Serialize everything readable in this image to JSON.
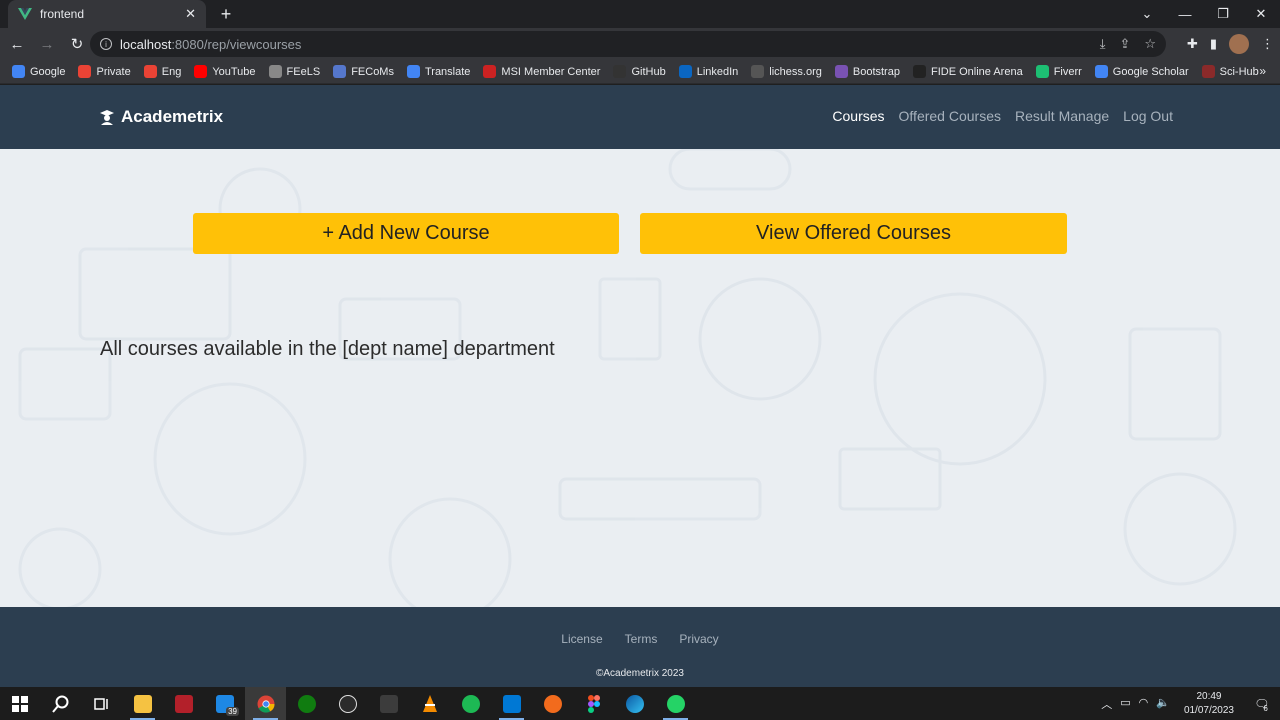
{
  "browser": {
    "tab_title": "frontend",
    "url_host": "localhost",
    "url_rest": ":8080/rep/viewcourses",
    "bookmarks": [
      {
        "label": "Google",
        "icon": "google-icon",
        "color": "#4285f4"
      },
      {
        "label": "Private",
        "icon": "gmail-icon",
        "color": "#ea4335"
      },
      {
        "label": "Eng",
        "icon": "gmail-icon",
        "color": "#ea4335"
      },
      {
        "label": "YouTube",
        "icon": "youtube-icon",
        "color": "#ff0000"
      },
      {
        "label": "FEeLS",
        "icon": "feels-icon",
        "color": "#888888"
      },
      {
        "label": "FECoMs",
        "icon": "fecoms-icon",
        "color": "#5577cc"
      },
      {
        "label": "Translate",
        "icon": "translate-icon",
        "color": "#4285f4"
      },
      {
        "label": "MSI Member Center",
        "icon": "msi-icon",
        "color": "#cc2222"
      },
      {
        "label": "GitHub",
        "icon": "github-icon",
        "color": "#333333"
      },
      {
        "label": "LinkedIn",
        "icon": "linkedin-icon",
        "color": "#0a66c2"
      },
      {
        "label": "lichess.org",
        "icon": "lichess-icon",
        "color": "#555555"
      },
      {
        "label": "Bootstrap",
        "icon": "bootstrap-icon",
        "color": "#7952b3"
      },
      {
        "label": "FIDE Online Arena",
        "icon": "fide-icon",
        "color": "#222222"
      },
      {
        "label": "Fiverr",
        "icon": "fiverr-icon",
        "color": "#1dbf73"
      },
      {
        "label": "Google Scholar",
        "icon": "scholar-icon",
        "color": "#4285f4"
      },
      {
        "label": "Sci-Hub",
        "icon": "scihub-icon",
        "color": "#8b2a2a"
      }
    ]
  },
  "navbar": {
    "brand": "Academetrix",
    "links": [
      {
        "label": "Courses",
        "active": true
      },
      {
        "label": "Offered Courses",
        "active": false
      },
      {
        "label": "Result Manage",
        "active": false
      },
      {
        "label": "Log Out",
        "active": false
      }
    ]
  },
  "main": {
    "add_button": "+ Add New Course",
    "view_button": "View Offered Courses",
    "dept_text": "All courses available in the [dept name] department"
  },
  "footer": {
    "links": [
      "License",
      "Terms",
      "Privacy"
    ],
    "copyright": "©Academetrix 2023"
  },
  "taskbar": {
    "badge_count": "39",
    "time": "20:49",
    "date": "01/07/2023",
    "notification_count": "6"
  },
  "colors": {
    "navbar_bg": "#2c3e50",
    "button_yellow": "#ffc107",
    "page_bg": "#eaeef2"
  }
}
